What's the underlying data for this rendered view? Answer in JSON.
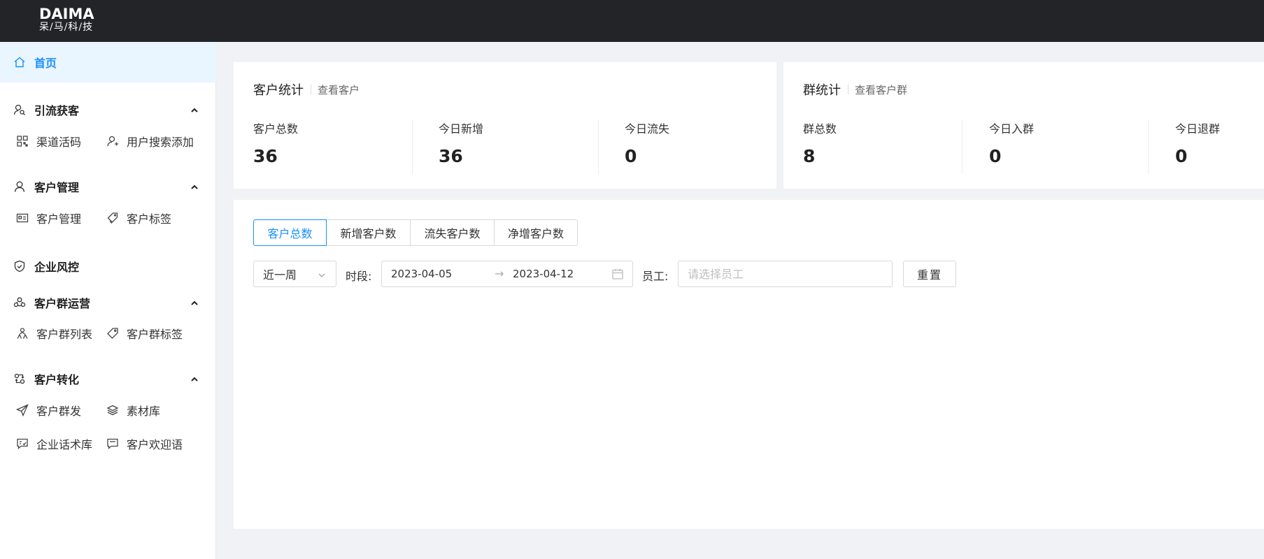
{
  "brand": {
    "logo_main": "DAIMA",
    "logo_sub": "呆/马/科/技"
  },
  "colors": {
    "accent": "#1890ff",
    "topbar": "#222427",
    "active_bg": "#e9f5ff"
  },
  "sidebar": {
    "home": {
      "label": "首页",
      "icon": "home-icon"
    },
    "groups": {
      "traffic": {
        "label": "引流获客",
        "icon": "user-search-icon",
        "items": [
          {
            "label": "渠道活码",
            "icon": "qrcode-icon"
          },
          {
            "label": "用户搜索添加",
            "icon": "user-add-icon"
          }
        ]
      },
      "customers": {
        "label": "客户管理",
        "icon": "user-icon",
        "items": [
          {
            "label": "客户管理",
            "icon": "id-card-icon"
          },
          {
            "label": "客户标签",
            "icon": "tags-icon"
          }
        ]
      },
      "risk": {
        "label": "企业风控",
        "icon": "shield-icon"
      },
      "group_ops": {
        "label": "客户群运营",
        "icon": "group-icon",
        "items": [
          {
            "label": "客户群列表",
            "icon": "people-icon"
          },
          {
            "label": "客户群标签",
            "icon": "tag-icon"
          }
        ]
      },
      "conversion": {
        "label": "客户转化",
        "icon": "conversion-icon",
        "items": [
          {
            "label": "客户群发",
            "icon": "send-icon"
          },
          {
            "label": "素材库",
            "icon": "layers-icon"
          },
          {
            "label": "企业话术库",
            "icon": "message-icon"
          },
          {
            "label": "客户欢迎语",
            "icon": "welcome-icon"
          }
        ]
      }
    }
  },
  "customer_stats": {
    "title": "客户统计",
    "link": "查看客户",
    "items": [
      {
        "label": "客户总数",
        "value": "36"
      },
      {
        "label": "今日新增",
        "value": "36"
      },
      {
        "label": "今日流失",
        "value": "0"
      }
    ]
  },
  "group_stats": {
    "title": "群统计",
    "link": "查看客户群",
    "items": [
      {
        "label": "群总数",
        "value": "8"
      },
      {
        "label": "今日入群",
        "value": "0"
      },
      {
        "label": "今日退群",
        "value": "0"
      }
    ]
  },
  "tabs": [
    {
      "label": "客户总数",
      "active": true
    },
    {
      "label": "新增客户数"
    },
    {
      "label": "流失客户数"
    },
    {
      "label": "净增客户数"
    }
  ],
  "filters": {
    "period_select": "近一周",
    "period_label": "时段:",
    "start_date": "2023-04-05",
    "end_date": "2023-04-12",
    "arrow": "→",
    "staff_label": "员工:",
    "staff_placeholder": "请选择员工",
    "reset_label": "重置"
  }
}
